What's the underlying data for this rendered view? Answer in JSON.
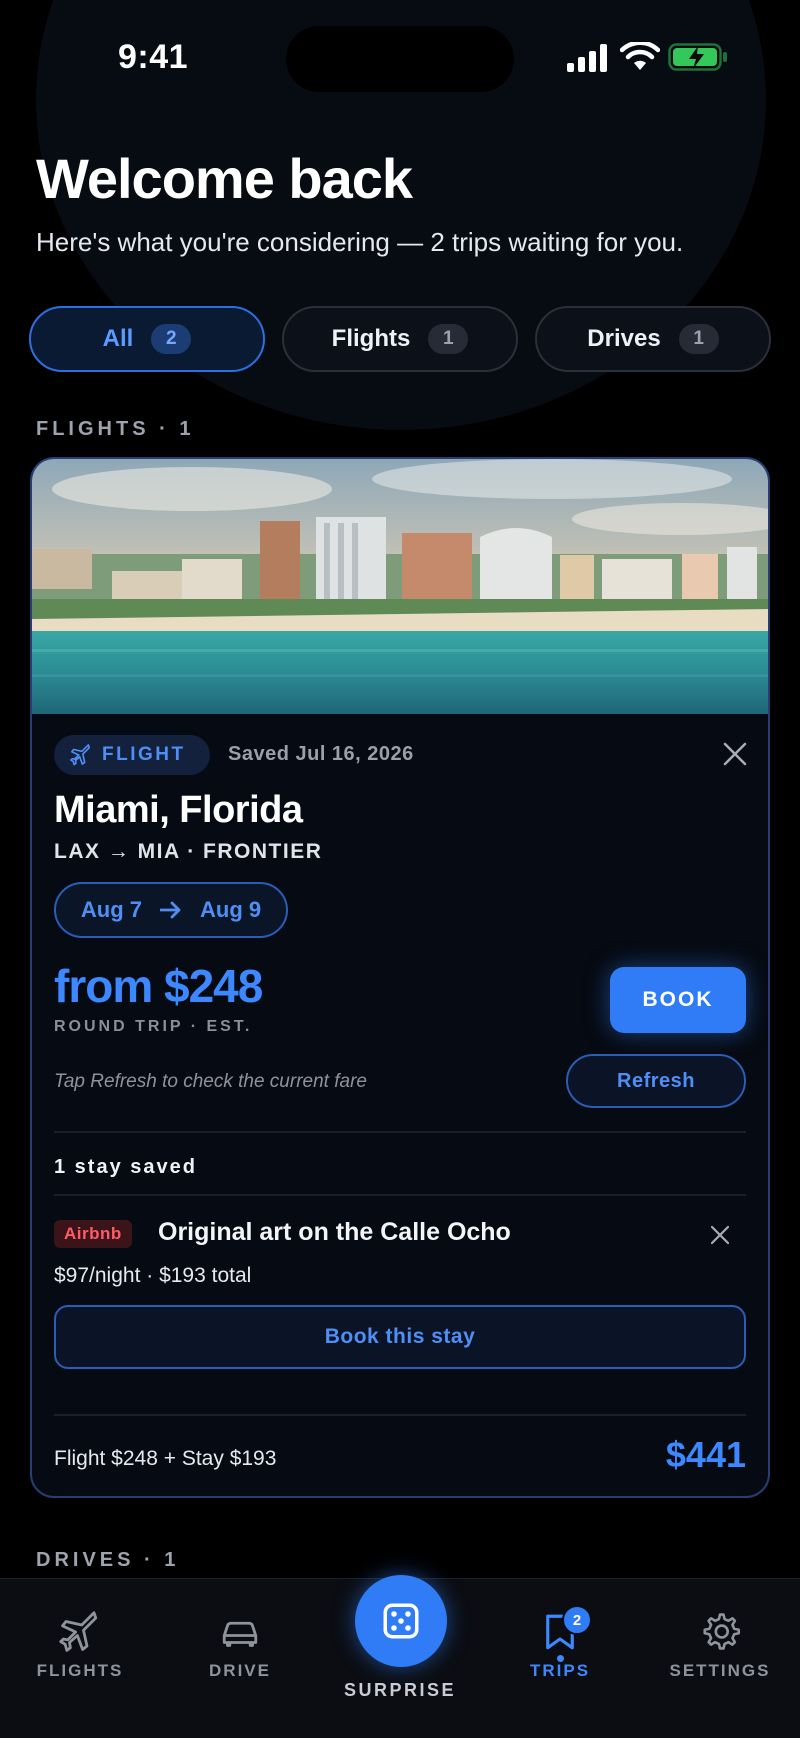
{
  "status_bar": {
    "time": "9:41"
  },
  "header": {
    "title": "Welcome back",
    "subtitle": "Here's what you're considering — 2 trips waiting for you."
  },
  "filters": [
    {
      "label": "All",
      "count": "2",
      "active": true
    },
    {
      "label": "Flights",
      "count": "1",
      "active": false
    },
    {
      "label": "Drives",
      "count": "1",
      "active": false
    }
  ],
  "sections": {
    "flights": "FLIGHTS · 1",
    "drives": "DRIVES · 1"
  },
  "flight_card": {
    "type_badge": "FLIGHT",
    "saved": "Saved Jul 16, 2026",
    "destination": "Miami, Florida",
    "route": "LAX → MIA · FRONTIER",
    "date_from": "Aug 7",
    "date_to": "Aug 9",
    "price": "from $248",
    "price_sub": "ROUND TRIP · EST.",
    "book_label": "BOOK",
    "hint": "Tap Refresh to check the current fare",
    "refresh_label": "Refresh",
    "stays_heading": "1 stay saved",
    "stay": {
      "source": "Airbnb",
      "title": "Original art on the Calle Ocho",
      "price": "$97/night · $193 total",
      "book_label": "Book this stay"
    },
    "total_breakdown": "Flight $248 + Stay $193",
    "total": "$441"
  },
  "tabbar": {
    "flights": "FLIGHTS",
    "drive": "DRIVE",
    "surprise": "SURPRISE",
    "trips": "TRIPS",
    "trips_badge": "2",
    "settings": "SETTINGS"
  },
  "colors": {
    "accent": "#2f7cf6",
    "background": "#000000",
    "card_border": "#253e73",
    "airbnb": "#ff5a67"
  }
}
